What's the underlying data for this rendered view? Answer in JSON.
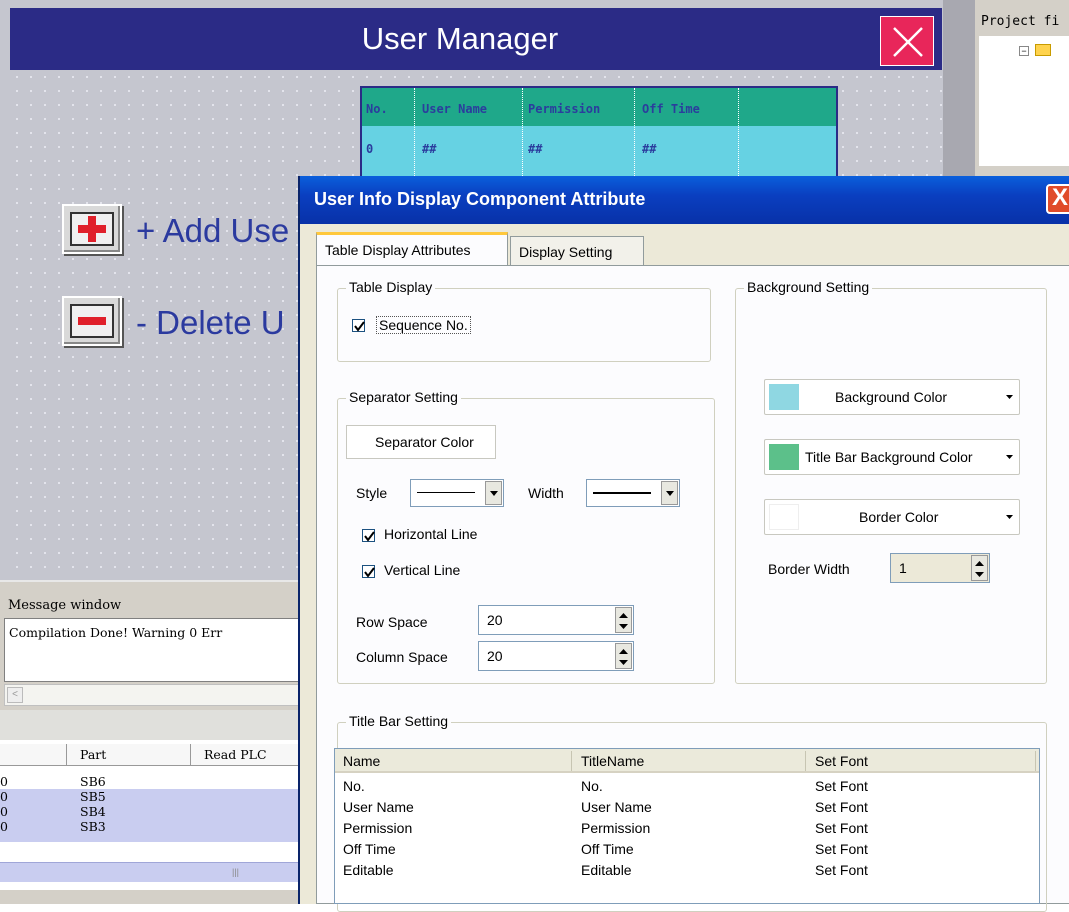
{
  "user_manager": {
    "title": "User Manager",
    "table_headers": [
      "No.",
      "User Name",
      "Permission",
      "Off Time"
    ],
    "table_row": [
      "0",
      "##",
      "##",
      "##"
    ],
    "add_label": "+ Add Use",
    "delete_label": "- Delete U"
  },
  "project_panel": {
    "title": "Project fi"
  },
  "message_window": {
    "title": "Message window",
    "text": "Compilation Done! Warning 0 Err"
  },
  "parts_list": {
    "headers": [
      "Part",
      "Read PLC"
    ],
    "rows": [
      {
        "prefix": "0",
        "part": "SB6",
        "selected": false
      },
      {
        "prefix": "0",
        "part": "SB5",
        "selected": true
      },
      {
        "prefix": "0",
        "part": "SB4",
        "selected": true
      },
      {
        "prefix": "0",
        "part": "SB3",
        "selected": true
      }
    ]
  },
  "dialog": {
    "title": "User Info Display Component Attribute",
    "tabs": [
      "Table Display Attributes",
      "Display Setting"
    ],
    "active_tab": "Table Display Attributes",
    "table_display": {
      "group_label": "Table Display",
      "sequence_label": "Sequence No.",
      "sequence_checked": true
    },
    "separator": {
      "group_label": "Separator Setting",
      "color_button": "Separator Color",
      "style_label": "Style",
      "width_label": "Width",
      "horizontal_label": "Horizontal Line",
      "horizontal_checked": true,
      "vertical_label": "Vertical Line",
      "vertical_checked": true,
      "row_space_label": "Row Space",
      "row_space_value": "20",
      "column_space_label": "Column Space",
      "column_space_value": "20"
    },
    "background": {
      "group_label": "Background Setting",
      "bg_color_label": "Background Color",
      "bg_color": "#8fd7e2",
      "title_bar_color_label": "Title Bar Background Color",
      "title_bar_color": "#5cc08a",
      "border_color_label": "Border Color",
      "border_color": "#ffffff",
      "border_width_label": "Border Width",
      "border_width_value": "1"
    },
    "title_bar": {
      "group_label": "Title Bar Setting",
      "columns": [
        "Name",
        "TitleName",
        "Set Font"
      ],
      "rows": [
        [
          "No.",
          "No.",
          "Set Font"
        ],
        [
          "User Name",
          "User Name",
          "Set Font"
        ],
        [
          "Permission",
          "Permission",
          "Set Font"
        ],
        [
          "Off Time",
          "Off Time",
          "Set Font"
        ],
        [
          "Editable",
          "Editable",
          "Set Font"
        ]
      ]
    },
    "close_glyph": "X"
  },
  "colors": {
    "um_titlebar": "#2b2b86",
    "um_close": "#e8265a",
    "table_header": "#1fa88a",
    "table_row": "#66d2e3",
    "dialog_title": "#0a3fc0",
    "add_icon": "#e0202a"
  }
}
